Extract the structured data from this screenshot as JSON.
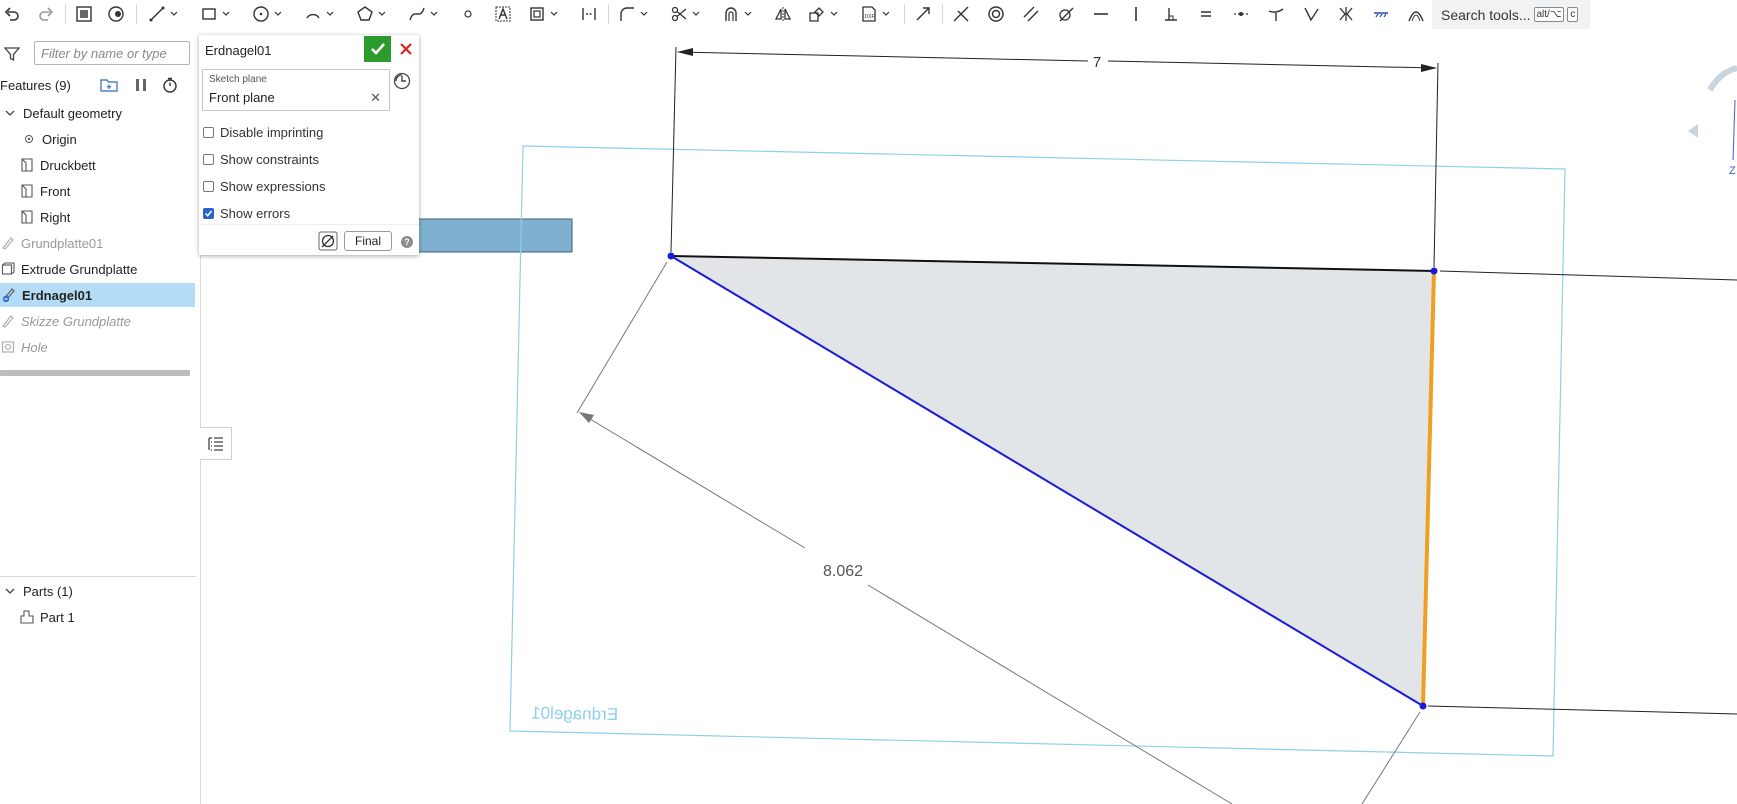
{
  "toolbar": {
    "search_label": "Search tools...",
    "shortcut_mod": "alt/⌥",
    "shortcut_key": "c"
  },
  "feature_tree": {
    "filter_placeholder": "Filter by name or type",
    "features_header": "Features (9)",
    "items": [
      {
        "label": "Default geometry"
      },
      {
        "label": "Origin"
      },
      {
        "label": "Druckbett"
      },
      {
        "label": "Front"
      },
      {
        "label": "Right"
      },
      {
        "label": "Grundplatte01"
      },
      {
        "label": "Extrude Grundplatte"
      },
      {
        "label": "Erdnagel01"
      },
      {
        "label": "Skizze Grundplatte"
      },
      {
        "label": "Hole"
      }
    ],
    "parts_header": "Parts (1)",
    "parts": [
      {
        "label": "Part 1"
      }
    ]
  },
  "sketch_dialog": {
    "name": "Erdnagel01",
    "sketch_plane_label": "Sketch plane",
    "sketch_plane_value": "Front plane",
    "options": [
      {
        "label": "Disable imprinting",
        "checked": false
      },
      {
        "label": "Show constraints",
        "checked": false
      },
      {
        "label": "Show expressions",
        "checked": false
      },
      {
        "label": "Show errors",
        "checked": true
      }
    ],
    "final_label": "Final",
    "help_label": "?"
  },
  "viewport": {
    "dimension_top": "7",
    "dimension_diagonal": "8.062",
    "plane_label": "Erdnagel01",
    "view_cube_letter": "Z",
    "colors": {
      "sketch_blue": "#1a1adb",
      "selected_orange": "#f0a020",
      "plane_outline": "#8fd0ea",
      "fill": "#e2e5e8"
    }
  }
}
